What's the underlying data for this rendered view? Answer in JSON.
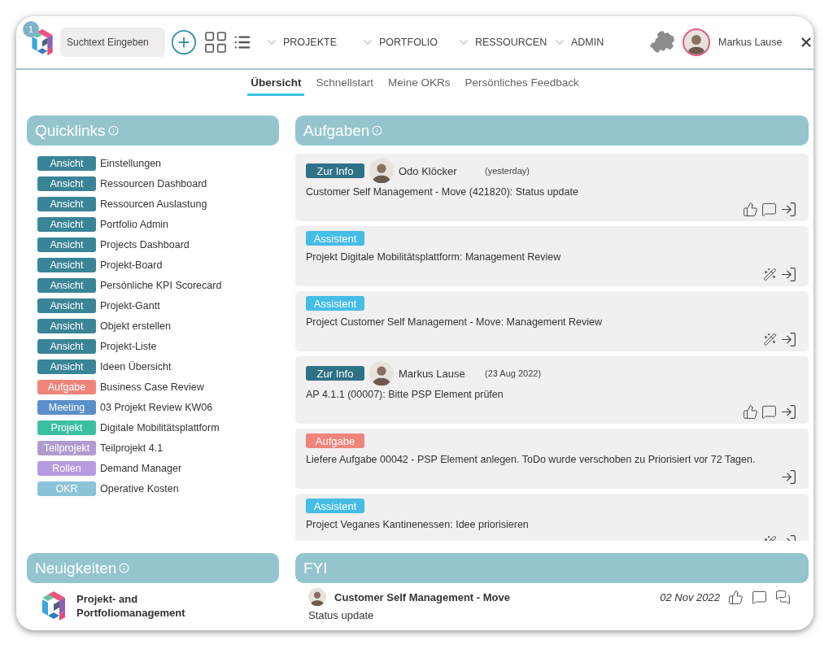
{
  "header": {
    "notification_count": "1",
    "search": {
      "placeholder": "Suchtext Eingeben"
    },
    "menus": [
      {
        "label": "PROJEKTE"
      },
      {
        "label": "PORTFOLIO"
      },
      {
        "label": "RESSOURCEN"
      },
      {
        "label": "ADMIN"
      }
    ],
    "user": {
      "name": "Markus Lause"
    }
  },
  "tabs": [
    {
      "label": "Übersicht",
      "selected": true
    },
    {
      "label": "Schnellstart",
      "selected": false
    },
    {
      "label": "Meine OKRs",
      "selected": false
    },
    {
      "label": "Persönliches Feedback",
      "selected": false
    }
  ],
  "quicklinks": {
    "title": "Quicklinks",
    "items": [
      {
        "tag": "Ansicht",
        "color": "#3a8497",
        "label": "Einstellungen"
      },
      {
        "tag": "Ansicht",
        "color": "#3a8497",
        "label": "Ressourcen Dashboard"
      },
      {
        "tag": "Ansicht",
        "color": "#3a8497",
        "label": "Ressourcen Auslastung"
      },
      {
        "tag": "Ansicht",
        "color": "#3a8497",
        "label": "Portfolio Admin"
      },
      {
        "tag": "Ansicht",
        "color": "#3a8497",
        "label": "Projects Dashboard"
      },
      {
        "tag": "Ansicht",
        "color": "#3a8497",
        "label": "Projekt-Board"
      },
      {
        "tag": "Ansicht",
        "color": "#3a8497",
        "label": "Persönliche KPI Scorecard"
      },
      {
        "tag": "Ansicht",
        "color": "#3a8497",
        "label": "Projekt-Gantt"
      },
      {
        "tag": "Ansicht",
        "color": "#3a8497",
        "label": "Objekt erstellen"
      },
      {
        "tag": "Ansicht",
        "color": "#3a8497",
        "label": "Projekt-Liste"
      },
      {
        "tag": "Ansicht",
        "color": "#3a8497",
        "label": "Ideen Übersicht"
      },
      {
        "tag": "Aufgabe",
        "color": "#ef857a",
        "label": "Business Case Review"
      },
      {
        "tag": "Meeting",
        "color": "#5b8fc9",
        "label": "03 Projekt Review KW06"
      },
      {
        "tag": "Projekt",
        "color": "#3bbfa3",
        "label": "Digitale Mobilitätsplattform"
      },
      {
        "tag": "Teilprojekt",
        "color": "#b19cd0",
        "label": "Teilprojekt 4.1"
      },
      {
        "tag": "Rollen",
        "color": "#b79be0",
        "label": "Demand Manager"
      },
      {
        "tag": "OKR",
        "color": "#8cc3d8",
        "label": "Operative Kosten"
      }
    ]
  },
  "tasks": {
    "title": "Aufgaben",
    "items": [
      {
        "kind": "info",
        "tag": "Zur Info",
        "author": "Odo Klöcker",
        "time": "(yesterday)",
        "text": "Customer Self Management - Move (421820): Status update"
      },
      {
        "kind": "assistant",
        "tag": "Assistent",
        "text": "Projekt Digitale Mobilitätsplattform: Management Review"
      },
      {
        "kind": "assistant",
        "tag": "Assistent",
        "text": "Project Customer Self Management - Move: Management Review"
      },
      {
        "kind": "info",
        "tag": "Zur Info",
        "author": "Markus Lause",
        "time": "(23 Aug 2022)",
        "text": "AP 4.1.1 (00007): Bitte PSP Element prüfen"
      },
      {
        "kind": "task",
        "tag": "Aufgabe",
        "text": "Liefere Aufgabe 00042 - PSP Element anlegen. ToDo wurde verschoben zu Priorisiert vor 72 Tagen."
      },
      {
        "kind": "assistant",
        "tag": "Assistent",
        "text": "Project Veganes Kantinenessen: Idee priorisieren"
      }
    ]
  },
  "news": {
    "title": "Neuigkeiten",
    "items": [
      {
        "title": "Projekt- and Portfoliomanagement"
      }
    ]
  },
  "fyi": {
    "title": "FYI",
    "items": [
      {
        "title": "Customer Self Management - Move",
        "date": "02 Nov 2022",
        "text": "Status update"
      }
    ]
  }
}
